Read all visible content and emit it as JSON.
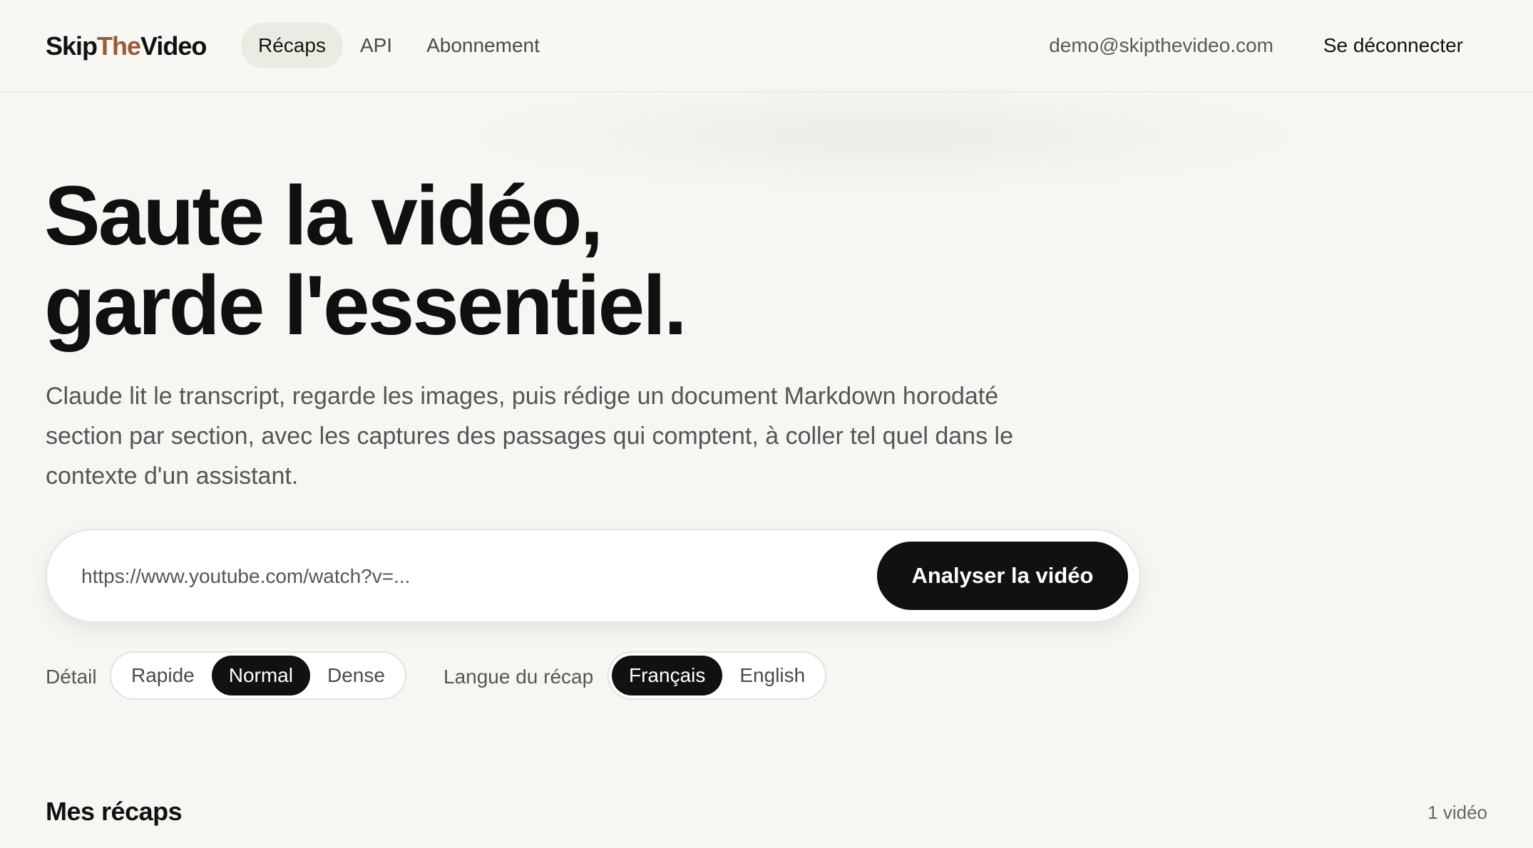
{
  "brand": {
    "part1": "Skip",
    "part2": "The",
    "part3": "Video",
    "accent_color": "#9a5a3c"
  },
  "nav": {
    "items": [
      {
        "label": "Récaps",
        "active": true
      },
      {
        "label": "API",
        "active": false
      },
      {
        "label": "Abonnement",
        "active": false
      }
    ]
  },
  "user": {
    "email": "demo@skipthevideo.com",
    "logout_label": "Se déconnecter"
  },
  "hero": {
    "title_line1": "Saute la vidéo,",
    "title_line2": "garde l'essentiel.",
    "description": "Claude lit le transcript, regarde les images, puis rédige un document Markdown horodaté section par section, avec les captures des passages qui comptent, à coller tel quel dans le contexte d'un assistant."
  },
  "url_form": {
    "placeholder": "https://www.youtube.com/watch?v=...",
    "value": "",
    "submit_label": "Analyser la vidéo"
  },
  "options": {
    "detail": {
      "label": "Détail",
      "choices": [
        "Rapide",
        "Normal",
        "Dense"
      ],
      "selected": "Normal"
    },
    "language": {
      "label": "Langue du récap",
      "choices": [
        "Français",
        "English"
      ],
      "selected": "Français"
    }
  },
  "recaps": {
    "title": "Mes récaps",
    "count_label": "1 vidéo"
  },
  "colors": {
    "background": "#f6f6f2",
    "primary": "#111111",
    "nav_active_bg": "#ecebe3"
  }
}
